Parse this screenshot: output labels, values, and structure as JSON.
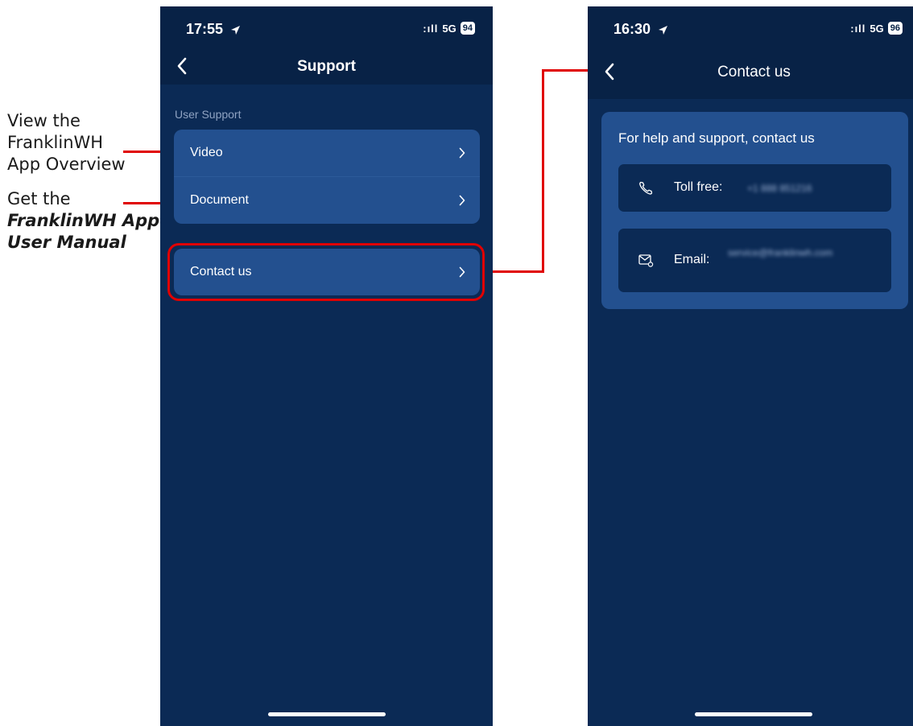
{
  "annotations": {
    "video_note": [
      "View the",
      "FranklinWH",
      "App Overview"
    ],
    "document_note": {
      "line1": "Get the",
      "line2": "FranklinWH App",
      "line3": "User Manual"
    },
    "highlight_color": "#e00000"
  },
  "support_screen": {
    "status": {
      "time": "17:55",
      "network": "5G",
      "battery": "94",
      "location_icon": "location-arrow-icon"
    },
    "nav": {
      "title": "Support",
      "back_icon": "chevron-left-icon"
    },
    "section_label": "User Support",
    "items": [
      {
        "label": "Video",
        "icon": "chevron-right-icon"
      },
      {
        "label": "Document",
        "icon": "chevron-right-icon"
      }
    ],
    "contact_item": {
      "label": "Contact us",
      "icon": "chevron-right-icon"
    }
  },
  "contact_screen": {
    "status": {
      "time": "16:30",
      "network": "5G",
      "battery": "96",
      "location_icon": "location-arrow-icon"
    },
    "nav": {
      "title": "Contact us",
      "back_icon": "chevron-left-icon"
    },
    "card_title": "For help and support, contact us",
    "toll_free": {
      "label": "Toll free:",
      "value_blurred": "+1 888 851216",
      "icon": "phone-icon"
    },
    "email": {
      "label": "Email:",
      "value_blurred": "service@franklinwh.com",
      "icon": "mail-icon"
    }
  },
  "colors": {
    "screen_bg": "#0b2a55",
    "card_bg": "#23508f",
    "accent_red": "#e00000"
  }
}
